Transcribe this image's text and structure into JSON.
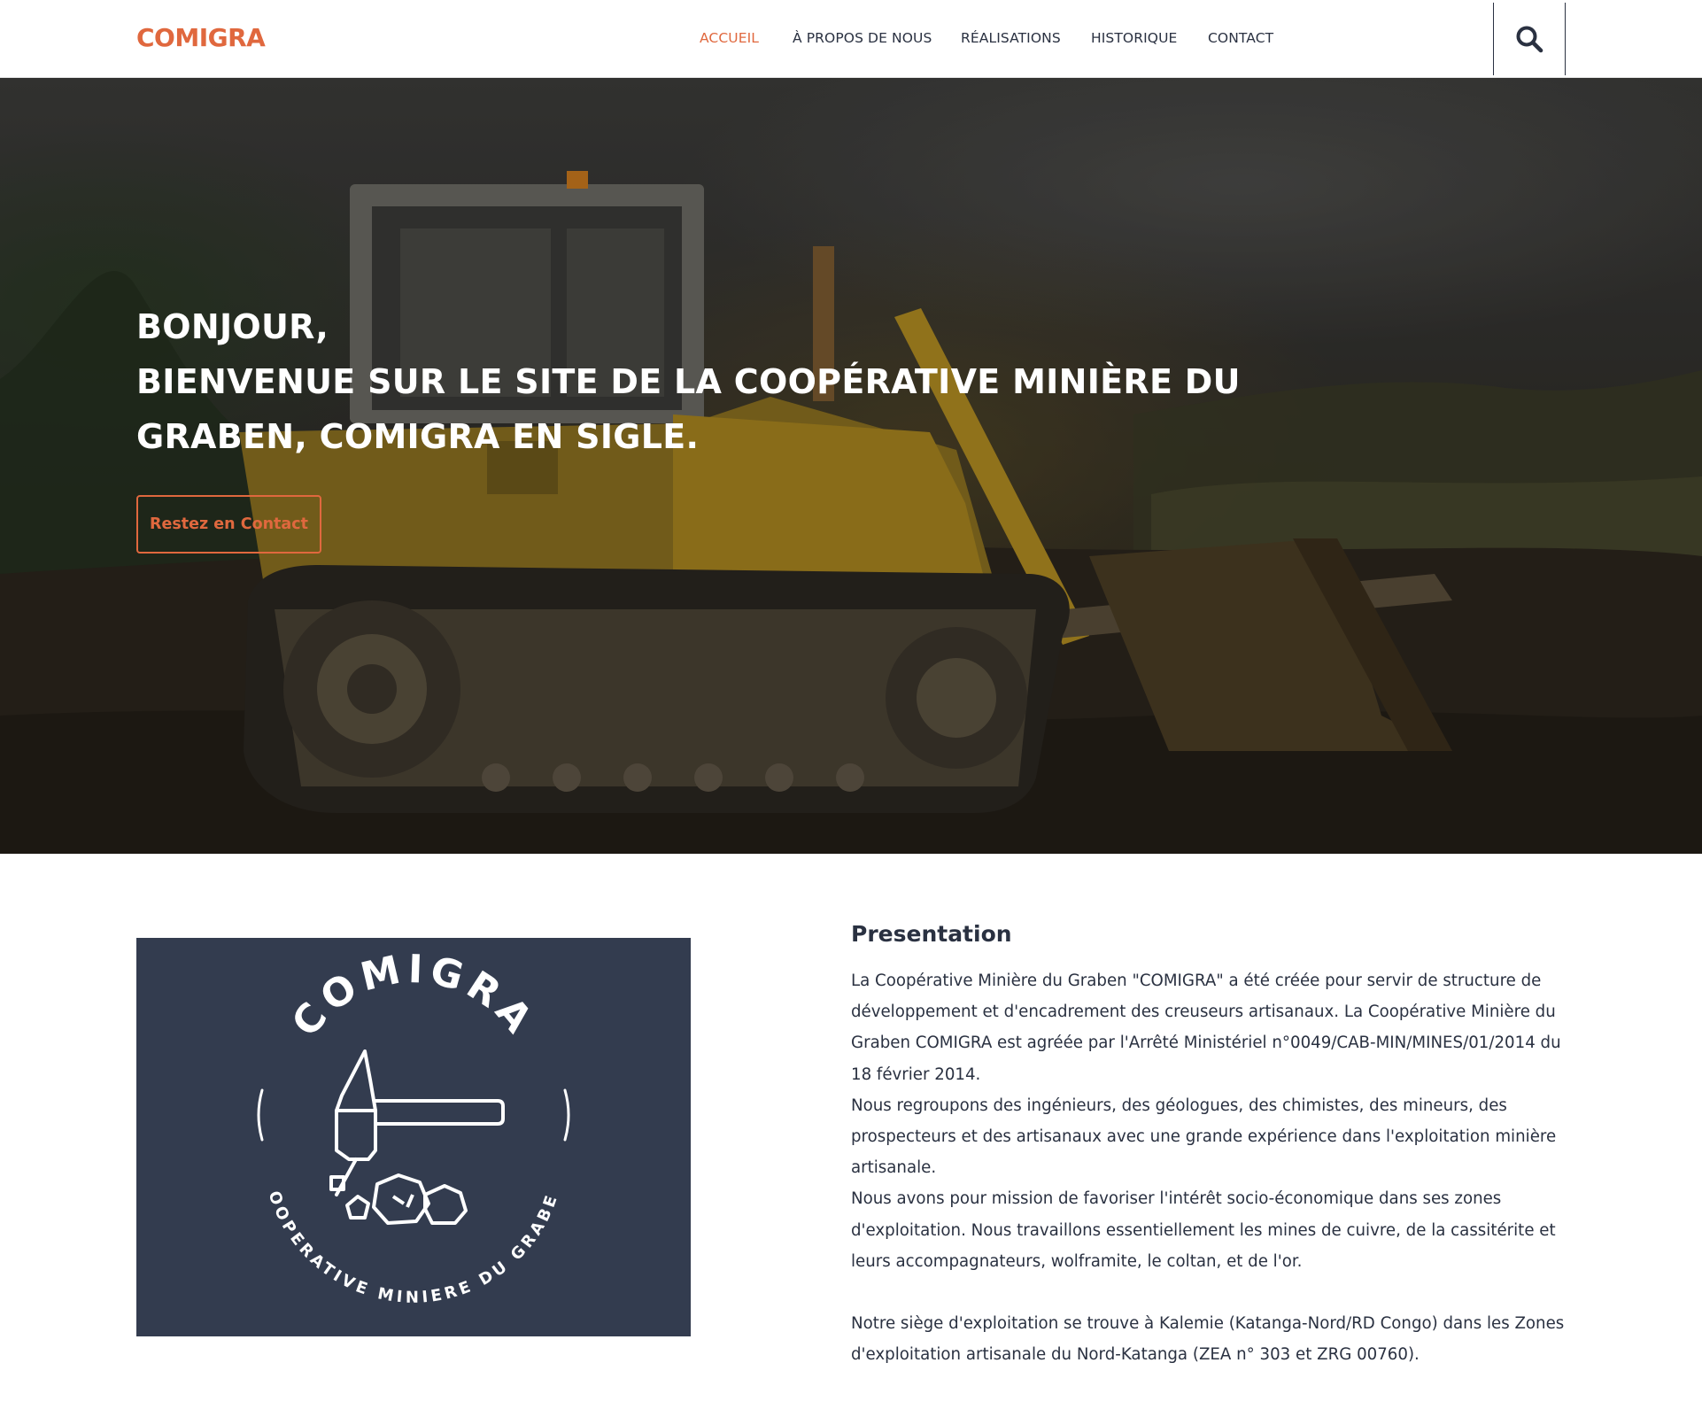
{
  "header": {
    "logo": "COMIGRA",
    "nav": [
      {
        "label": "ACCUEIL",
        "active": true
      },
      {
        "label": "À PROPOS DE NOUS",
        "active": false
      },
      {
        "label": "RÉALISATIONS",
        "active": false
      },
      {
        "label": "HISTORIQUE",
        "active": false
      },
      {
        "label": "CONTACT",
        "active": false
      }
    ],
    "search_icon": "search-icon"
  },
  "hero": {
    "title_lines": [
      "BONJOUR,",
      "BIENVENUE SUR LE SITE DE LA COOPÉRATIVE MINIÈRE DU",
      "GRABEN, COMIGRA EN SIGLE."
    ],
    "button": "Restez en Contact",
    "image_subject": "bulldozer"
  },
  "presentation": {
    "logo": {
      "top_text": "COMIGRA",
      "bottom_text": "COOPERATIVE MINIERE DU GRABEN"
    },
    "title": "Presentation",
    "paragraphs": [
      "La Coopérative Minière du Graben \"COMIGRA\" a été créée pour servir de structure de développement et d'encadrement des creuseurs artisanaux. La Coopérative Minière du Graben COMIGRA est agréée par l'Arrêté Ministériel n°0049/CAB-MIN/MINES/01/2014 du 18 février 2014.",
      "Nous regroupons des ingénieurs, des géologues, des chimistes, des mineurs, des prospecteurs et des artisanaux avec une grande expérience dans l'exploitation minière artisanale.",
      "Nous avons pour mission de favoriser l'intérêt socio-économique dans ses zones d'exploitation. Nous travaillons essentiellement les mines de cuivre, de la cassitérite et leurs accompagnateurs, wolframite, le coltan, et de l'or.",
      "Notre siège d'exploitation se trouve à Kalemie (Katanga-Nord/RD Congo) dans les Zones d'exploitation artisanale du Nord-Katanga (ZEA n° 303 et ZRG 00760)."
    ]
  },
  "colors": {
    "accent": "#e0683e",
    "text": "#2a3141",
    "logo_panel": "#333c4f"
  }
}
